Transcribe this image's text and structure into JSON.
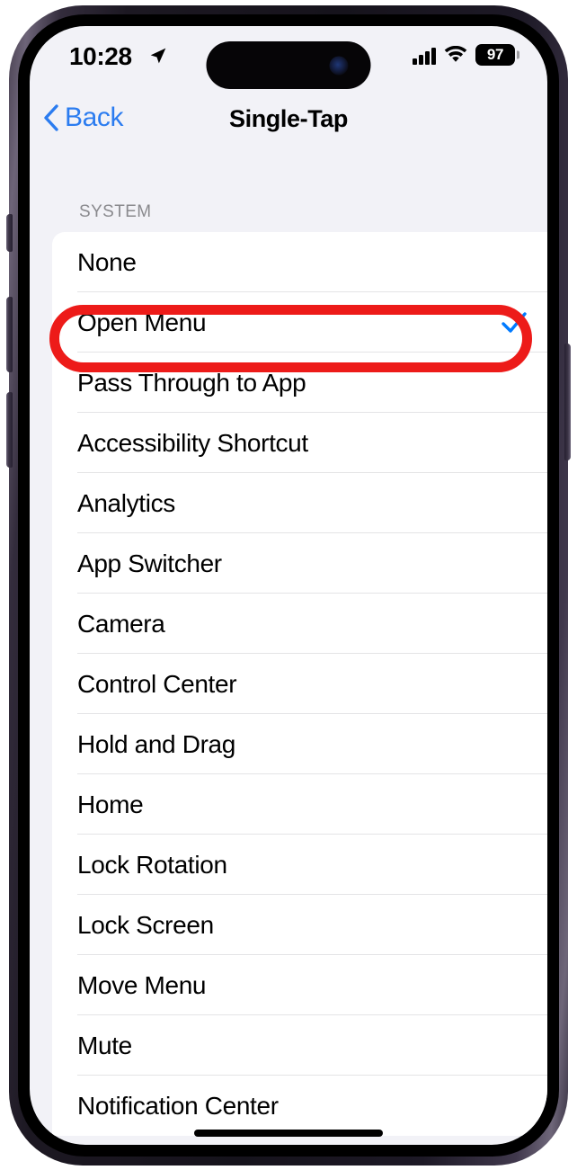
{
  "status_bar": {
    "time": "10:28",
    "location_icon": "location-arrow-icon",
    "signal_icon": "cellular-signal-icon",
    "wifi_icon": "wifi-icon",
    "battery_level": "97"
  },
  "nav_bar": {
    "back_label": "Back",
    "back_icon": "chevron-left-icon",
    "title": "Single-Tap"
  },
  "list": {
    "section_header": "SYSTEM",
    "rows": [
      {
        "label": "None",
        "selected": false
      },
      {
        "label": "Open Menu",
        "selected": true
      },
      {
        "label": "Pass Through to App",
        "selected": false
      },
      {
        "label": "Accessibility Shortcut",
        "selected": false
      },
      {
        "label": "Analytics",
        "selected": false
      },
      {
        "label": "App Switcher",
        "selected": false
      },
      {
        "label": "Camera",
        "selected": false
      },
      {
        "label": "Control Center",
        "selected": false
      },
      {
        "label": "Hold and Drag",
        "selected": false
      },
      {
        "label": "Home",
        "selected": false
      },
      {
        "label": "Lock Rotation",
        "selected": false
      },
      {
        "label": "Lock Screen",
        "selected": false
      },
      {
        "label": "Move Menu",
        "selected": false
      },
      {
        "label": "Mute",
        "selected": false
      },
      {
        "label": "Notification Center",
        "selected": false
      }
    ]
  },
  "annotation": {
    "type": "red-oval-highlight",
    "target_label": "Open Menu",
    "color": "#ed1b19"
  },
  "colors": {
    "accent_blue": "#007aff",
    "back_blue": "#2b7cf0",
    "grouped_background": "#f2f2f7",
    "card_background": "#ffffff",
    "separator": "#e4e4e6",
    "section_header_text": "#8a8a8e"
  }
}
